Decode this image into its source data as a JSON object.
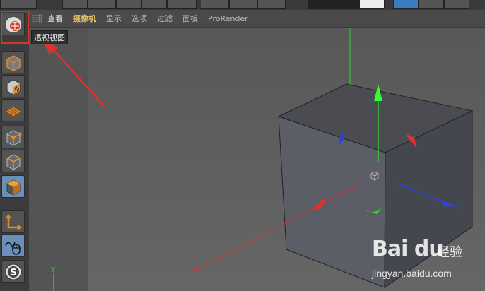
{
  "viewport_menu": {
    "items": [
      {
        "label": "查看"
      },
      {
        "label": "摄像机"
      },
      {
        "label": "显示"
      },
      {
        "label": "选项"
      },
      {
        "label": "过滤"
      },
      {
        "label": "面板"
      },
      {
        "label": "ProRender"
      }
    ],
    "active_index": 1
  },
  "tooltip": {
    "text": "透视视图"
  },
  "tools": [
    {
      "name": "perspective-view-icon"
    },
    {
      "name": "model-mode-icon"
    },
    {
      "name": "texture-mode-icon"
    },
    {
      "name": "workplane-mode-icon"
    },
    {
      "name": "point-mode-icon"
    },
    {
      "name": "edge-mode-icon"
    },
    {
      "name": "polygon-mode-icon"
    },
    {
      "name": "axis-mode-icon"
    },
    {
      "name": "tweak-mode-icon"
    },
    {
      "name": "snap-icon"
    }
  ],
  "axis_label": {
    "y": "Y"
  },
  "watermark": {
    "logo": "Bai du",
    "brand_cn": "经验",
    "url": "jingyan.baidu.com"
  },
  "colors": {
    "x_axis": "#e03030",
    "y_axis": "#30d030",
    "z_axis": "#3040e0",
    "highlight": "#d9342b",
    "active_menu": "#e8c36a"
  }
}
